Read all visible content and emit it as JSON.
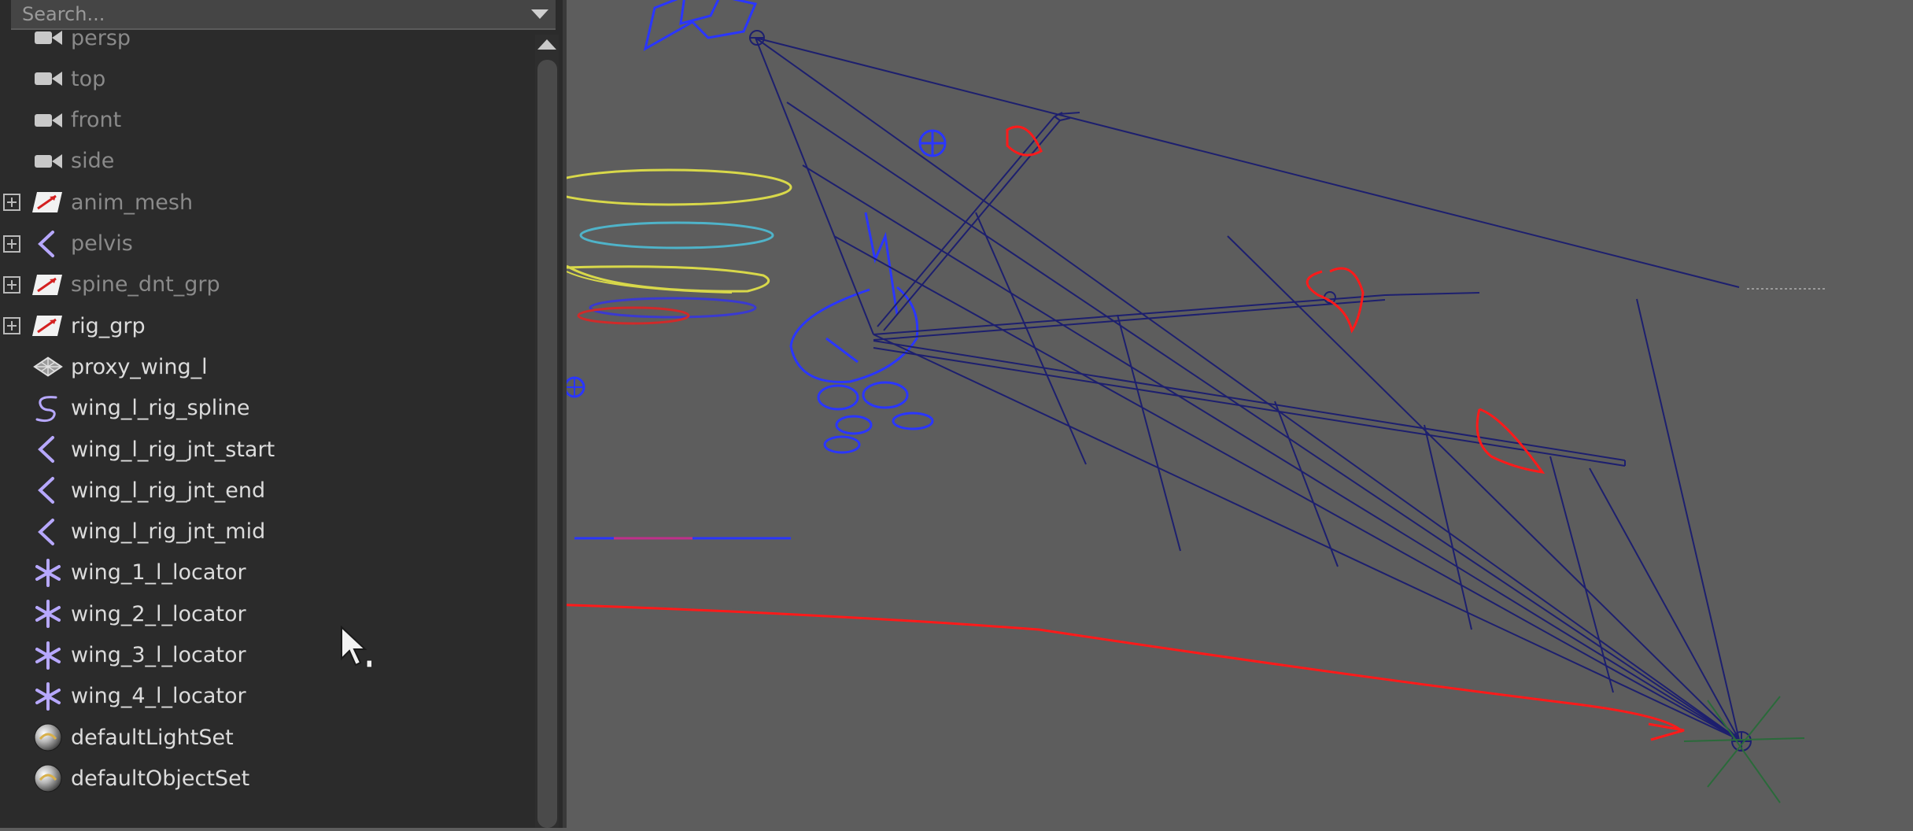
{
  "search": {
    "placeholder": "Search..."
  },
  "outliner": {
    "items": [
      {
        "label": "persp",
        "icon": "camera-icon",
        "dim": true,
        "expand": false
      },
      {
        "label": "top",
        "icon": "camera-icon",
        "dim": true,
        "expand": false
      },
      {
        "label": "front",
        "icon": "camera-icon",
        "dim": true,
        "expand": false
      },
      {
        "label": "side",
        "icon": "camera-icon",
        "dim": true,
        "expand": false
      },
      {
        "label": "anim_mesh",
        "icon": "group-icon",
        "dim": true,
        "expand": true
      },
      {
        "label": "pelvis",
        "icon": "joint-icon",
        "dim": true,
        "expand": true
      },
      {
        "label": "spine_dnt_grp",
        "icon": "group-icon",
        "dim": true,
        "expand": true
      },
      {
        "label": "rig_grp",
        "icon": "group-icon",
        "dim": false,
        "expand": true
      },
      {
        "label": "proxy_wing_l",
        "icon": "mesh-icon",
        "dim": false,
        "expand": false
      },
      {
        "label": "wing_l_rig_spline",
        "icon": "curve-icon",
        "dim": false,
        "expand": false
      },
      {
        "label": "wing_l_rig_jnt_start",
        "icon": "joint-icon",
        "dim": false,
        "expand": false
      },
      {
        "label": "wing_l_rig_jnt_end",
        "icon": "joint-icon",
        "dim": false,
        "expand": false
      },
      {
        "label": "wing_l_rig_jnt_mid",
        "icon": "joint-icon",
        "dim": false,
        "expand": false
      },
      {
        "label": "wing_1_l_locator",
        "icon": "locator-icon",
        "dim": false,
        "expand": false
      },
      {
        "label": "wing_2_l_locator",
        "icon": "locator-icon",
        "dim": false,
        "expand": false
      },
      {
        "label": "wing_3_l_locator",
        "icon": "locator-icon",
        "dim": false,
        "expand": false
      },
      {
        "label": "wing_4_l_locator",
        "icon": "locator-icon",
        "dim": false,
        "expand": false
      },
      {
        "label": "defaultLightSet",
        "icon": "set-icon",
        "dim": false,
        "expand": false
      },
      {
        "label": "defaultObjectSet",
        "icon": "set-icon",
        "dim": false,
        "expand": false
      }
    ]
  },
  "colors": {
    "panel": "#2b2b2b",
    "viewport": "#5d5d5d",
    "wireframe": "#1d1f6e",
    "annotation": "#ff1a1a",
    "controls": "#2a36ff"
  }
}
